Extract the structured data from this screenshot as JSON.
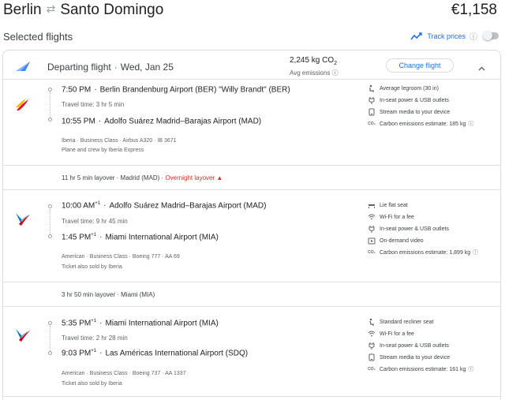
{
  "header": {
    "origin": "Berlin",
    "destination": "Santo Domingo",
    "price": "€1,158"
  },
  "subheader": {
    "title": "Selected flights",
    "track_label": "Track prices"
  },
  "departing": {
    "label": "Departing flight",
    "date": "Wed, Jan 25",
    "emissions_value": "2,245 kg CO",
    "emissions_sub": "2",
    "emissions_label": "Avg emissions",
    "change_label": "Change flight"
  },
  "segments": [
    {
      "dep_time": "7:50 PM",
      "dep_plus": "",
      "dep_airport": "Berlin Brandenburg Airport (BER) \"Willy Brandt\" (BER)",
      "travel_time": "Travel time: 3 hr 5 min",
      "arr_time": "10:55 PM",
      "arr_plus": "",
      "arr_airport": "Adolfo Suárez Madrid–Barajas Airport (MAD)",
      "details": "Iberia · Business Class · Airbus A320 · IB 3671",
      "extra": "Plane and crew by Iberia Express",
      "amenities": [
        "Average legroom (30 in)",
        "In-seat power & USB outlets",
        "Stream media to your device",
        "Carbon emissions estimate: 185 kg"
      ]
    },
    {
      "dep_time": "10:00 AM",
      "dep_plus": "+1",
      "dep_airport": "Adolfo Suárez Madrid–Barajas Airport (MAD)",
      "travel_time": "Travel time: 9 hr 45 min",
      "arr_time": "1:45 PM",
      "arr_plus": "+1",
      "arr_airport": "Miami International Airport (MIA)",
      "details": "American · Business Class · Boeing 777 · AA 69",
      "extra": "Ticket also sold by Iberia",
      "amenities": [
        "Lie flat seat",
        "Wi-Fi for a fee",
        "In-seat power & USB outlets",
        "On-demand video",
        "Carbon emissions estimate: 1,899 kg"
      ]
    },
    {
      "dep_time": "5:35 PM",
      "dep_plus": "+1",
      "dep_airport": "Miami International Airport (MIA)",
      "travel_time": "Travel time: 2 hr 28 min",
      "arr_time": "9:03 PM",
      "arr_plus": "+1",
      "arr_airport": "Las Américas International Airport (SDQ)",
      "details": "American · Business Class · Boeing 737 · AA 1337",
      "extra": "Ticket also sold by Iberia",
      "amenities": [
        "Standard recliner seat",
        "Wi-Fi for a fee",
        "In-seat power & USB outlets",
        "Stream media to your device",
        "Carbon emissions estimate: 161 kg"
      ]
    }
  ],
  "layovers": [
    {
      "text": "11 hr 5 min layover · Madrid (MAD) · ",
      "warning": "Overnight layover"
    },
    {
      "text": "3 hr 50 min layover · Miami (MIA)",
      "warning": ""
    }
  ],
  "colors": {
    "accent": "#1a73e8",
    "warning": "#d93025",
    "iberia_red": "#d7192d",
    "iberia_yellow": "#f6b700",
    "american_red": "#c30019",
    "american_blue": "#0078d2"
  }
}
